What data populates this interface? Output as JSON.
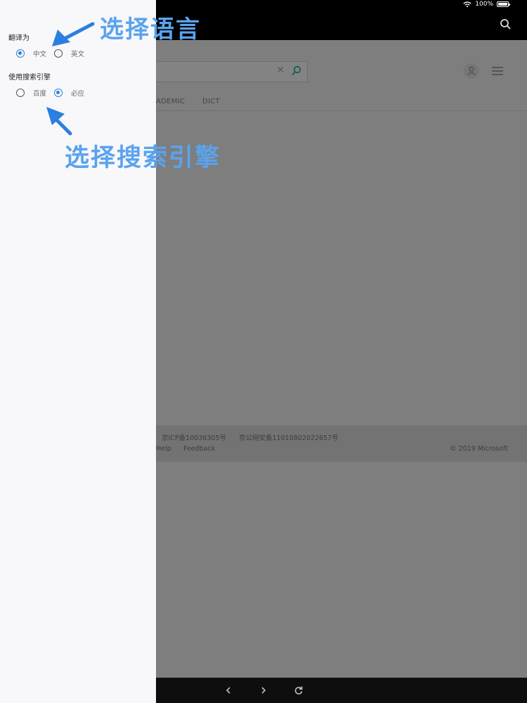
{
  "status_bar": {
    "battery_text": "100%"
  },
  "webpage": {
    "search_clear_glyph": "✕",
    "tabs": [
      "ADEMIC",
      "DICT"
    ],
    "footer": {
      "icp": "京ICP备10036305号",
      "police": "京公网安备11010802022657号",
      "help": "Help",
      "feedback": "Feedback",
      "copyright": "© 2019 Microsoft"
    }
  },
  "panel": {
    "translate_title": "翻译为",
    "translate_options": [
      "中文",
      "英文"
    ],
    "translate_selected": "中文",
    "engine_title": "使用搜索引擎",
    "engine_options": [
      "百度",
      "必应"
    ],
    "engine_selected": "必应"
  },
  "annotations": {
    "language": "选择语言",
    "engine": "选择搜索引擎"
  },
  "colors": {
    "accent": "#2b86d6",
    "annotation": "#5aa3ee",
    "panel_bg": "#f8f7fa",
    "dim_overlay": "#7e7e7e"
  }
}
